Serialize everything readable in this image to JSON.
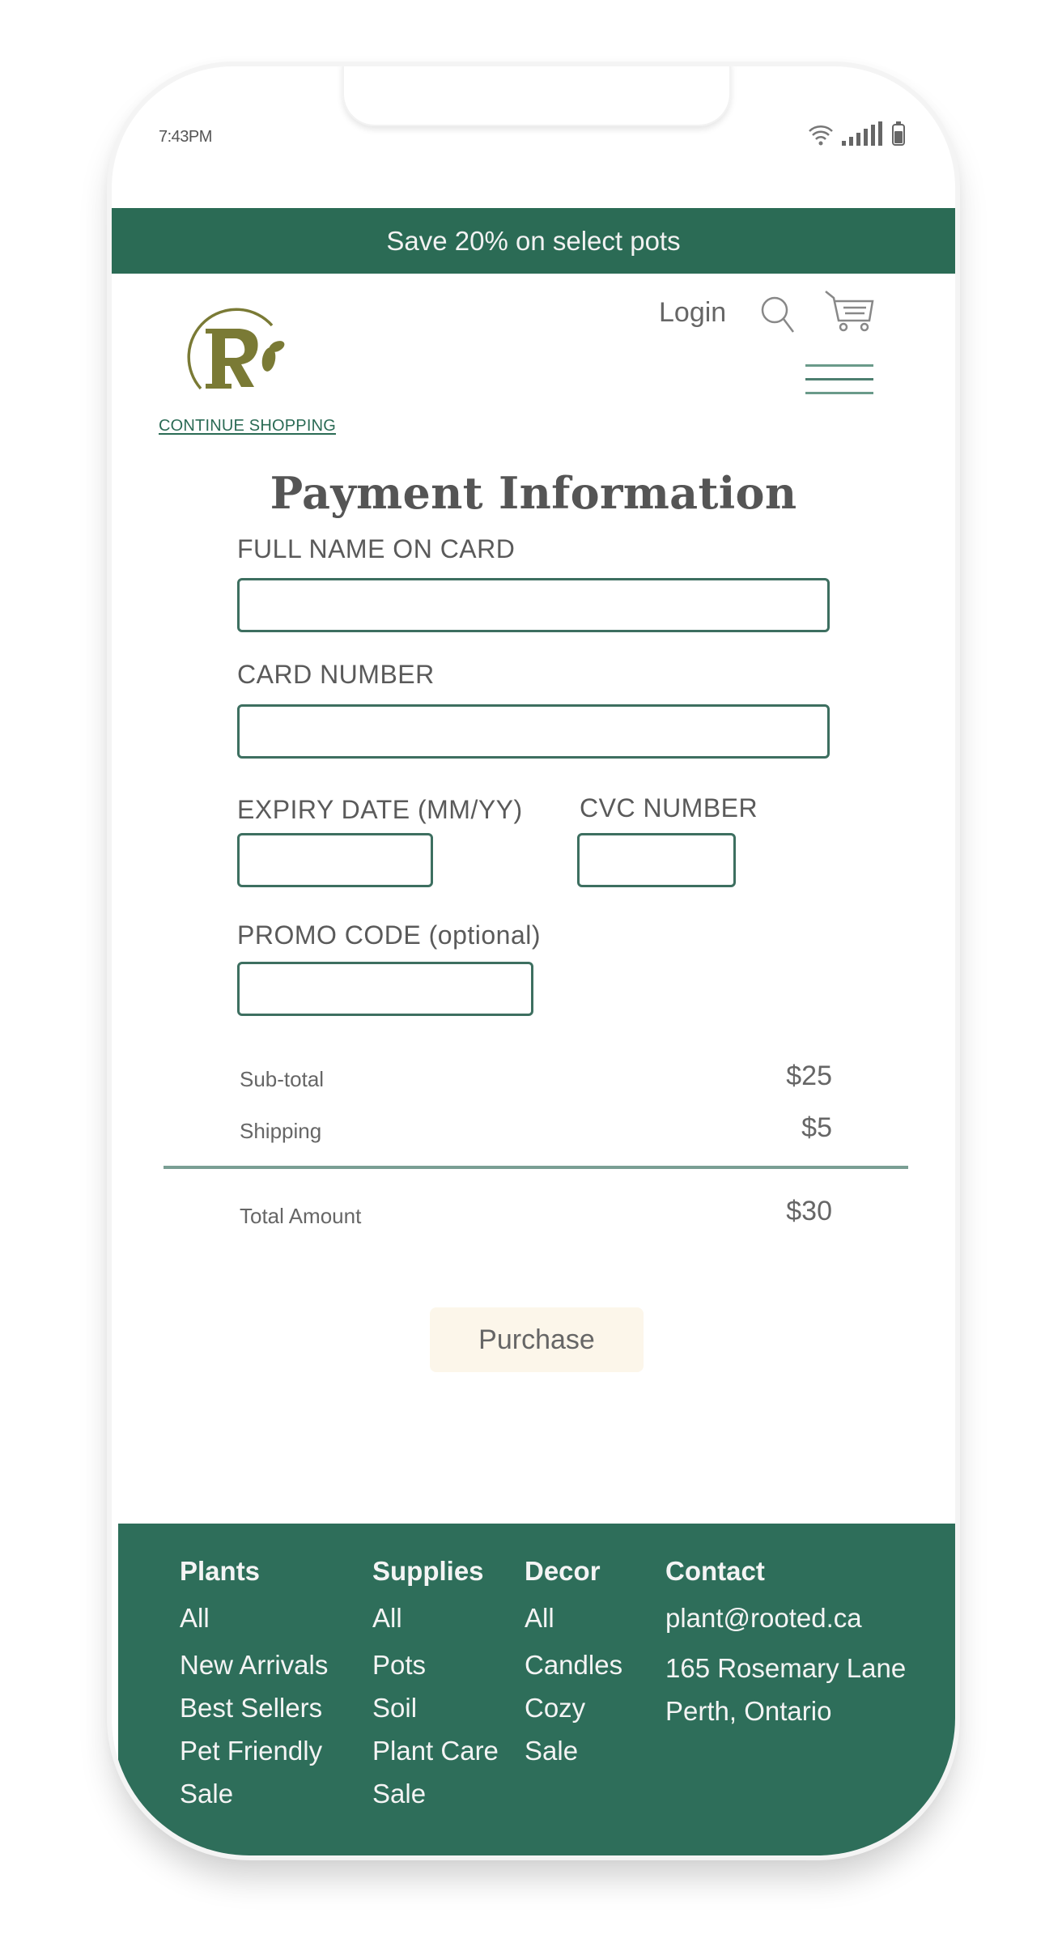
{
  "status_bar": {
    "time": "7:43PM",
    "icons": [
      "wifi-icon",
      "signal-icon",
      "battery-icon"
    ]
  },
  "promo_banner": "Save 20% on select pots",
  "header": {
    "logo_letter": "R",
    "continue_shopping": "CONTINUE SHOPPING",
    "login": "Login",
    "icons": [
      "search-icon",
      "cart-icon",
      "hamburger-menu-icon"
    ]
  },
  "page_title": "Payment Information",
  "form": {
    "full_name": {
      "label": "FULL NAME ON CARD",
      "value": "",
      "placeholder": ""
    },
    "card_number": {
      "label": "CARD NUMBER",
      "value": "",
      "placeholder": ""
    },
    "expiry": {
      "label": "EXPIRY DATE (MM/YY)",
      "value": "",
      "placeholder": ""
    },
    "cvc": {
      "label": "CVC NUMBER",
      "value": "",
      "placeholder": ""
    },
    "promo": {
      "label": "PROMO CODE (optional)",
      "value": "",
      "placeholder": ""
    }
  },
  "summary": {
    "subtotal_label": "Sub-total",
    "subtotal_value": "$25",
    "shipping_label": "Shipping",
    "shipping_value": "$5",
    "total_label": "Total Amount",
    "total_value": "$30"
  },
  "purchase_button": "Purchase",
  "footer": {
    "columns": [
      {
        "heading": "Plants",
        "items": [
          "All",
          "New Arrivals",
          "Best Sellers",
          "Pet Friendly",
          "Sale"
        ]
      },
      {
        "heading": "Supplies",
        "items": [
          "All",
          "Pots",
          "Soil",
          "Plant Care",
          "Sale"
        ]
      },
      {
        "heading": "Decor",
        "items": [
          "All",
          "Candles",
          "Cozy",
          "Sale"
        ]
      },
      {
        "heading": "Contact",
        "items": [
          "plant@rooted.ca",
          "165 Rosemary Lane",
          "Perth, Ontario"
        ]
      }
    ]
  },
  "colors": {
    "brand_green": "#2b6b55",
    "logo_olive": "#7a7a35",
    "button_bg": "#fcf6ea"
  }
}
